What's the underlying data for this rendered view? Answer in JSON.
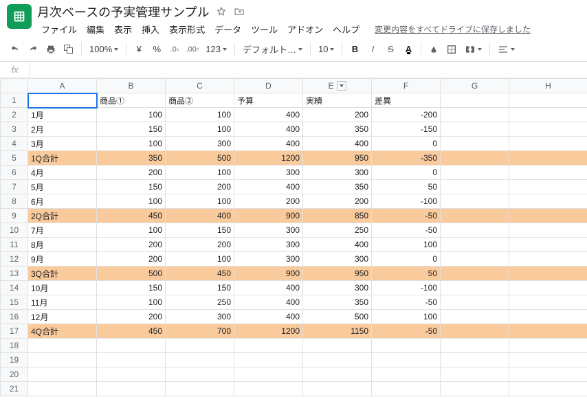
{
  "header": {
    "title": "月次ベースの予実管理サンプル",
    "save_status": "変更内容をすべてドライブに保存しました"
  },
  "menu": {
    "file": "ファイル",
    "edit": "編集",
    "view": "表示",
    "insert": "挿入",
    "format": "表示形式",
    "data": "データ",
    "tools": "ツール",
    "addons": "アドオン",
    "help": "ヘルプ"
  },
  "toolbar": {
    "zoom": "100%",
    "currency": "¥",
    "percent": "%",
    "dec_dec": ".0",
    "dec_inc": ".00",
    "numfmt": "123",
    "font": "デフォルト…",
    "fontsize": "10",
    "bold": "B",
    "italic": "I",
    "strike": "S",
    "textcolor": "A"
  },
  "formula": {
    "fx": "fx",
    "value": ""
  },
  "columns": [
    "A",
    "B",
    "C",
    "D",
    "E",
    "F",
    "G",
    "H"
  ],
  "headers": {
    "B": "商品①",
    "C": "商品②",
    "D": "予算",
    "E": "実績",
    "F": "差異"
  },
  "rows": [
    {
      "n": 1,
      "A": "",
      "B": "商品①",
      "C": "商品②",
      "D": "予算",
      "E": "実績",
      "F": "差異",
      "hl": false,
      "header": true,
      "selected": "A"
    },
    {
      "n": 2,
      "A": "1月",
      "B": 100,
      "C": 100,
      "D": 400,
      "E": 200,
      "F": -200,
      "hl": false
    },
    {
      "n": 3,
      "A": "2月",
      "B": 150,
      "C": 100,
      "D": 400,
      "E": 350,
      "F": -150,
      "hl": false
    },
    {
      "n": 4,
      "A": "3月",
      "B": 100,
      "C": 300,
      "D": 400,
      "E": 400,
      "F": 0,
      "hl": false
    },
    {
      "n": 5,
      "A": "1Q合計",
      "B": 350,
      "C": 500,
      "D": 1200,
      "E": 950,
      "F": -350,
      "hl": true
    },
    {
      "n": 6,
      "A": "4月",
      "B": 200,
      "C": 100,
      "D": 300,
      "E": 300,
      "F": 0,
      "hl": false
    },
    {
      "n": 7,
      "A": "5月",
      "B": 150,
      "C": 200,
      "D": 400,
      "E": 350,
      "F": 50,
      "hl": false
    },
    {
      "n": 8,
      "A": "6月",
      "B": 100,
      "C": 100,
      "D": 200,
      "E": 200,
      "F": -100,
      "hl": false
    },
    {
      "n": 9,
      "A": "2Q合計",
      "B": 450,
      "C": 400,
      "D": 900,
      "E": 850,
      "F": -50,
      "hl": true
    },
    {
      "n": 10,
      "A": "7月",
      "B": 100,
      "C": 150,
      "D": 300,
      "E": 250,
      "F": -50,
      "hl": false
    },
    {
      "n": 11,
      "A": "8月",
      "B": 200,
      "C": 200,
      "D": 300,
      "E": 400,
      "F": 100,
      "hl": false
    },
    {
      "n": 12,
      "A": "9月",
      "B": 200,
      "C": 100,
      "D": 300,
      "E": 300,
      "F": 0,
      "hl": false
    },
    {
      "n": 13,
      "A": "3Q合計",
      "B": 500,
      "C": 450,
      "D": 900,
      "E": 950,
      "F": 50,
      "hl": true
    },
    {
      "n": 14,
      "A": "10月",
      "B": 150,
      "C": 150,
      "D": 400,
      "E": 300,
      "F": -100,
      "hl": false
    },
    {
      "n": 15,
      "A": "11月",
      "B": 100,
      "C": 250,
      "D": 400,
      "E": 350,
      "F": -50,
      "hl": false
    },
    {
      "n": 16,
      "A": "12月",
      "B": 200,
      "C": 300,
      "D": 400,
      "E": 500,
      "F": 100,
      "hl": false
    },
    {
      "n": 17,
      "A": "4Q合計",
      "B": 450,
      "C": 700,
      "D": 1200,
      "E": 1150,
      "F": -50,
      "hl": true
    },
    {
      "n": 18
    },
    {
      "n": 19
    },
    {
      "n": 20
    },
    {
      "n": 21
    }
  ]
}
